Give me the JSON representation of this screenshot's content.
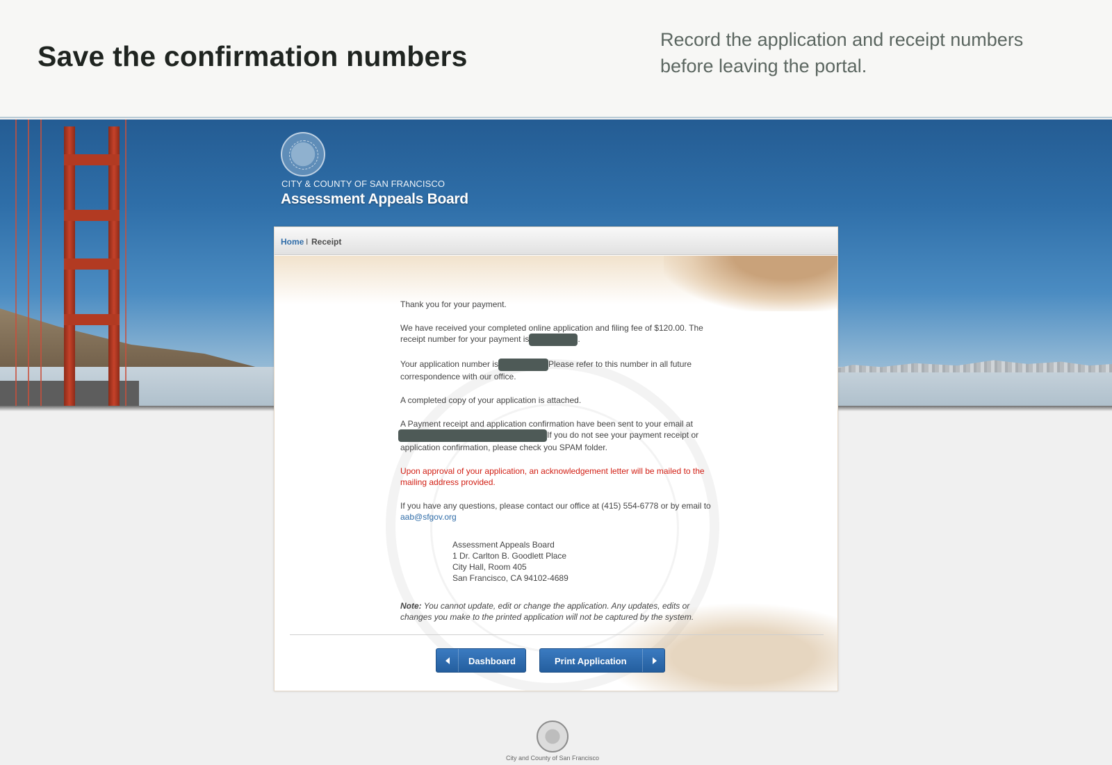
{
  "caption": {
    "title": "Save the confirmation numbers",
    "description": "Record the application and receipt numbers before leaving the portal."
  },
  "header": {
    "org_line": "CITY & COUNTY OF SAN FRANCISCO",
    "org_name": "Assessment Appeals Board"
  },
  "breadcrumb": {
    "home": "Home",
    "separator": "I",
    "current": "Receipt"
  },
  "receipt": {
    "thanks": "Thank you for your payment.",
    "received_before": "We have received your completed online application and filing fee of $120.00. The receipt number for your payment is",
    "received_after": ".",
    "app_before": "Your application number is",
    "app_after": "Please refer to this number in all future correspondence with our office.",
    "copy": "A completed copy of your application is attached.",
    "email_before": "A Payment receipt and application confirmation have been sent to your email at",
    "email_after": "If you do not see your payment receipt or application confirmation, please check you SPAM folder.",
    "approval": "Upon approval of your application, an acknowledgement letter will be mailed to the mailing address provided.",
    "questions": "If you have any questions, please contact our office at (415) 554-6778 or by email to",
    "contact_email": "aab@sfgov.org",
    "address": [
      "Assessment Appeals Board",
      "1 Dr. Carlton B. Goodlett Place",
      "City Hall, Room 405",
      "San Francisco, CA 94102-4689"
    ],
    "note_label": "Note:",
    "note_text": "You cannot update, edit or change the application. Any updates, edits or changes you make to the printed application will not be captured by the system."
  },
  "buttons": {
    "dashboard": "Dashboard",
    "print": "Print Application"
  },
  "footer": {
    "text": "City and County of San Francisco"
  },
  "colors": {
    "link": "#2f6ca8",
    "alert": "#d11d12",
    "button": "#2f6ca8",
    "redaction": "#4e5a57"
  },
  "icons": {
    "dashboard": "chevron-left-icon",
    "print": "chevron-right-icon"
  }
}
